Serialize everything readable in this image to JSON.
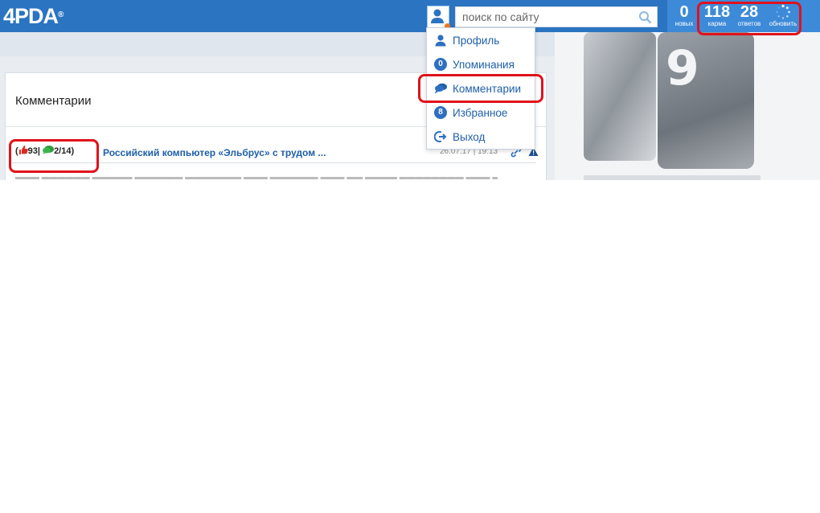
{
  "header": {
    "logo_text": "4PDA",
    "logo_mark": "®",
    "search_placeholder": "поиск по сайту",
    "counters": [
      {
        "value": "0",
        "label": "новых"
      },
      {
        "value": "118",
        "label": "карма"
      },
      {
        "value": "28",
        "label": "ответов"
      },
      {
        "value": "",
        "label": "обновить"
      }
    ]
  },
  "dropdown": {
    "items": [
      {
        "label": "Профиль",
        "icon": "user-icon",
        "badge": ""
      },
      {
        "label": "Упоминания",
        "icon": "badge",
        "badge": "0"
      },
      {
        "label": "Комментарии",
        "icon": "comments-icon",
        "badge": ""
      },
      {
        "label": "Избранное",
        "icon": "badge",
        "badge": "8"
      },
      {
        "label": "Выход",
        "icon": "logout-icon",
        "badge": ""
      }
    ]
  },
  "panel": {
    "title": "Комментарии",
    "comment": {
      "likes": "93",
      "comments": "2/14",
      "title": "Российский компьютер «Эльбрус» с трудом ...",
      "date": "26.07.17 | 19:13"
    }
  },
  "colors": {
    "header_bg": "#2a74c1",
    "counters_bg": "#3d8ad9",
    "highlight": "#e0121b",
    "link": "#1f5fa9"
  }
}
